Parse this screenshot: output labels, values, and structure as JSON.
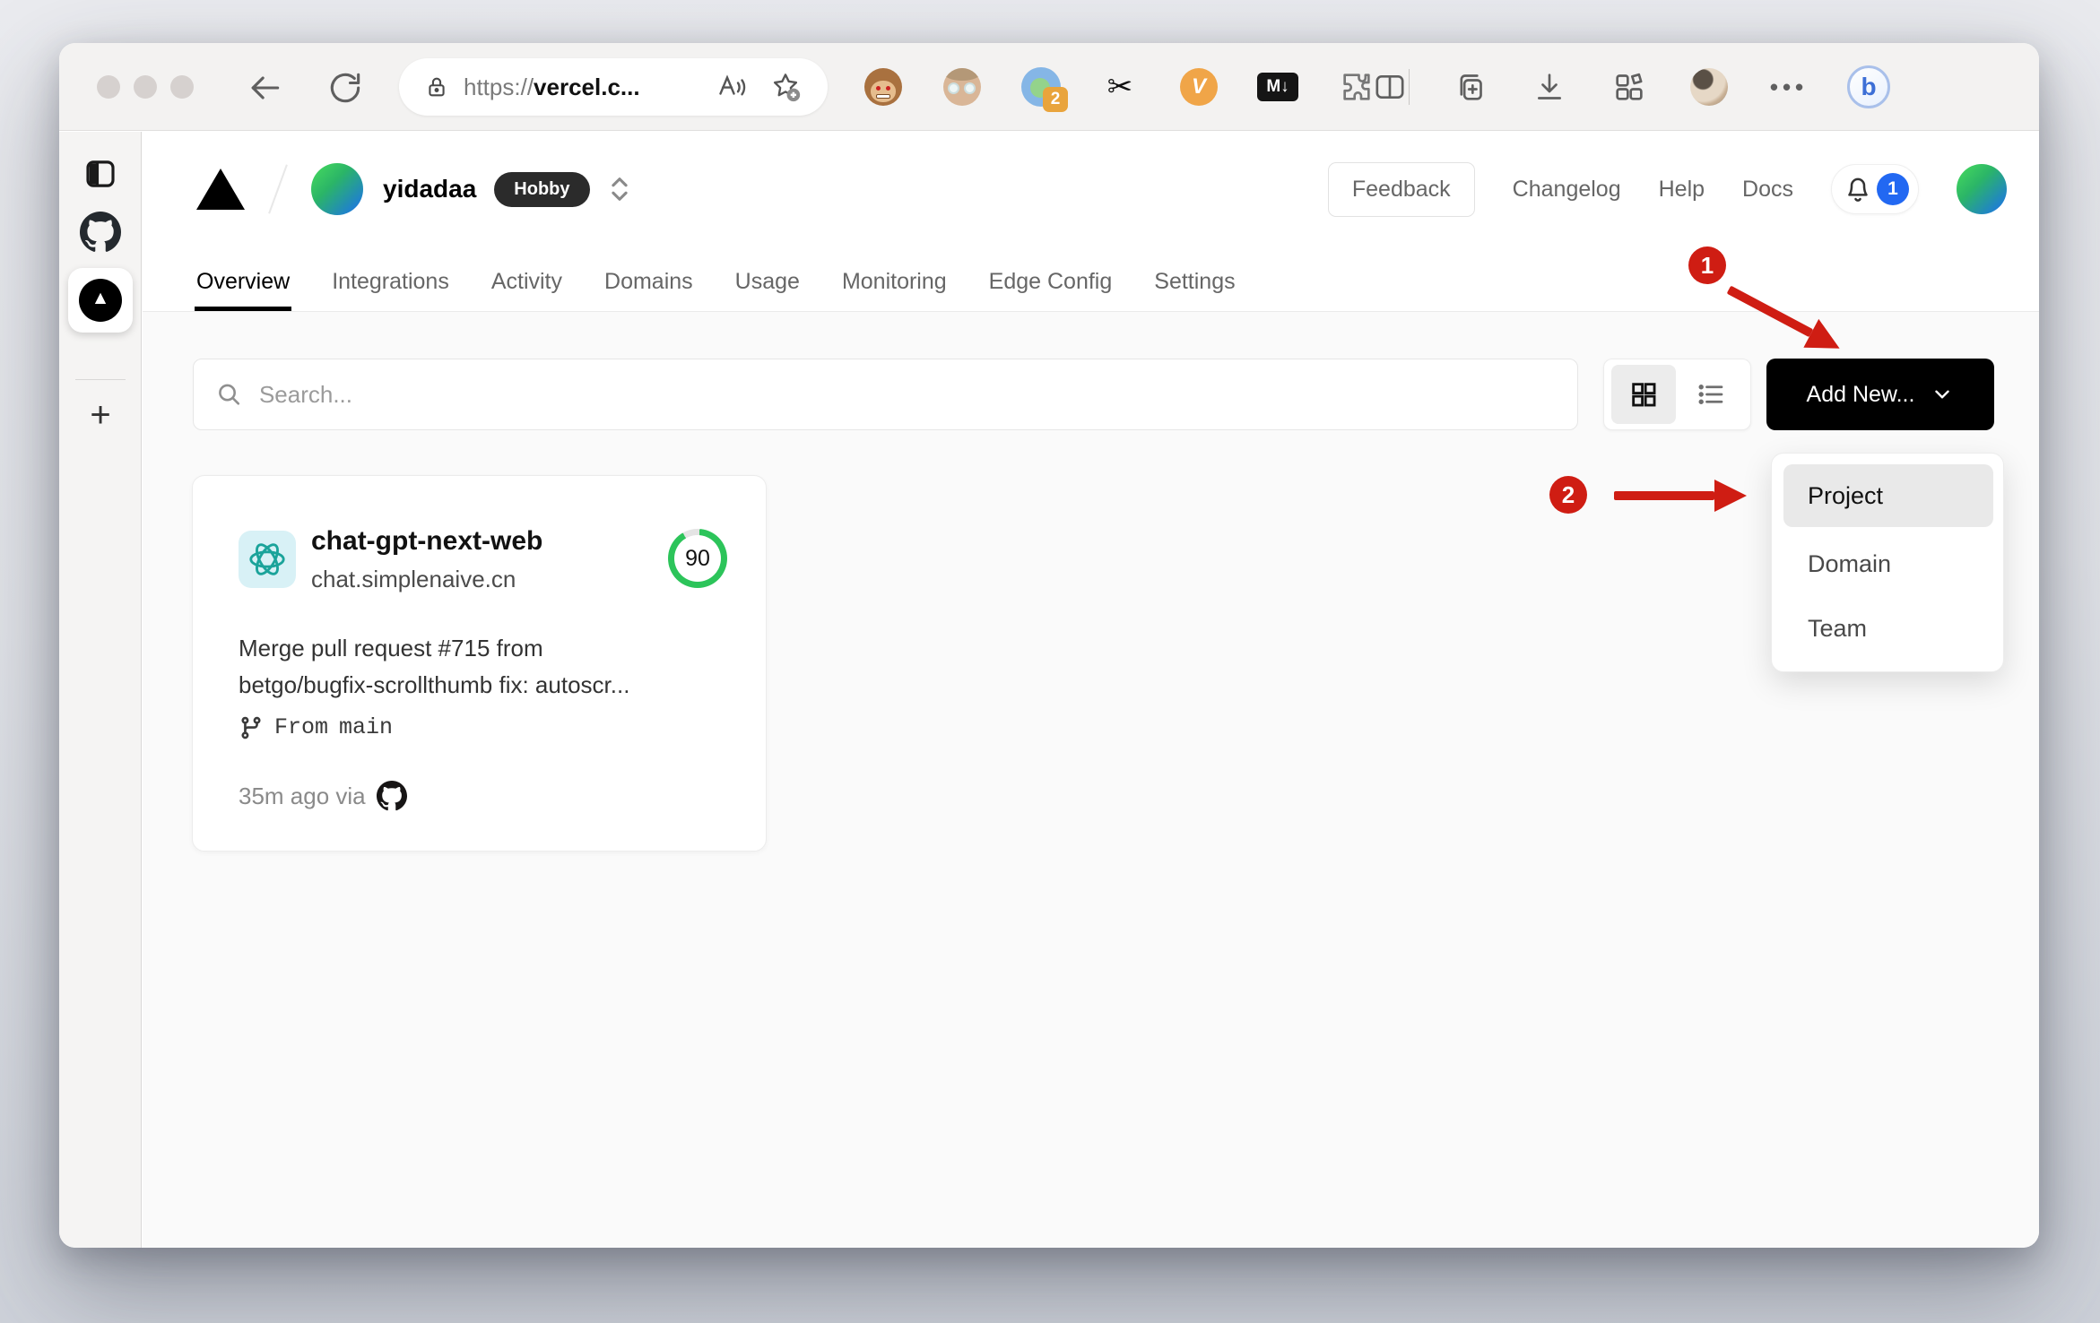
{
  "browser": {
    "url": {
      "scheme": "https://",
      "host": "vercel.c..."
    },
    "extension_badge": "2",
    "scissors_glyph": "✂",
    "v_ext": "V",
    "markdown_ext": "M↓",
    "more_glyph": "•••",
    "bing": "b"
  },
  "edge_sidebar": {
    "vercel_glyph": "▲",
    "new_tab": "+"
  },
  "vercel": {
    "team": "yidadaa",
    "plan": "Hobby",
    "actions": {
      "feedback": "Feedback",
      "changelog": "Changelog",
      "help": "Help",
      "docs": "Docs",
      "notifications": "1"
    },
    "tabs": [
      "Overview",
      "Integrations",
      "Activity",
      "Domains",
      "Usage",
      "Monitoring",
      "Edge Config",
      "Settings"
    ],
    "search_placeholder": "Search...",
    "add_new": "Add New...",
    "menu": {
      "project": "Project",
      "domain": "Domain",
      "team": "Team"
    },
    "card": {
      "name": "chat-gpt-next-web",
      "domain": "chat.simplenaive.cn",
      "score": "90",
      "commit_line1": "Merge pull request #715 from",
      "commit_line2": "betgo/bugfix-scrollthumb fix: autoscr...",
      "from_label": "From",
      "branch": "main",
      "time": "35m ago via"
    }
  },
  "annotations": {
    "step1": "1",
    "step2": "2",
    "color": "#cf1d13"
  }
}
